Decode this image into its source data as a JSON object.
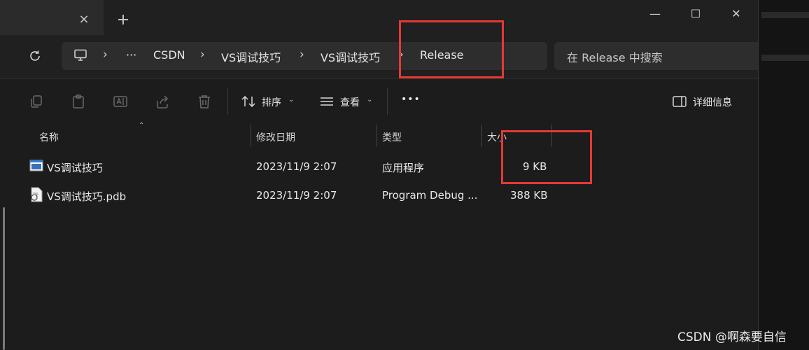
{
  "window": {
    "tab_close": "×",
    "new_tab": "+",
    "minimize": "—",
    "maximize": "☐",
    "close": "✕"
  },
  "address": {
    "more": "···",
    "breadcrumbs": [
      "CSDN",
      "VS调试技巧",
      "VS调试技巧",
      "Release"
    ],
    "separator": "›"
  },
  "search": {
    "placeholder": "在 Release 中搜索"
  },
  "toolbar": {
    "sort_label": "排序",
    "view_label": "查看",
    "more": "•••",
    "details_label": "详细信息",
    "chevron": "⌄"
  },
  "columns": {
    "name": "名称",
    "modified": "修改日期",
    "type": "类型",
    "size": "大小"
  },
  "files": [
    {
      "name": "VS调试技巧",
      "modified": "2023/11/9 2:07",
      "type": "应用程序",
      "size": "9 KB"
    },
    {
      "name": "VS调试技巧.pdb",
      "modified": "2023/11/9 2:07",
      "type": "Program Debug ...",
      "size": "388 KB"
    }
  ],
  "watermark": "CSDN @啊森要自信",
  "colors": {
    "highlight": "#e53935",
    "background": "#1c1c1c"
  }
}
